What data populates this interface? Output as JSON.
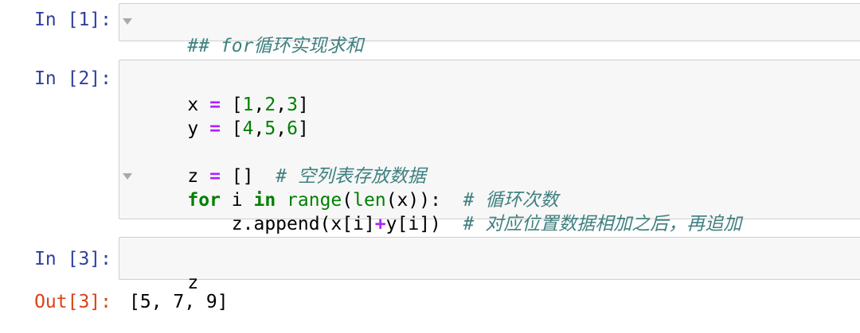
{
  "cells": [
    {
      "prompt": "In [1]:",
      "code": [
        "## for循环实现求和"
      ]
    },
    {
      "prompt": "In [2]:",
      "code": [
        "x = [1,2,3]",
        "y = [4,5,6]",
        "",
        "z = []  # 空列表存放数据",
        "for i in range(len(x)):  # 循环次数",
        "    z.append(x[i]+y[i])  # 对应位置数据相加之后，再追加"
      ]
    },
    {
      "prompt": "In [3]:",
      "code": [
        "z"
      ]
    }
  ],
  "output": {
    "prompt": "Out[3]:",
    "text": "[5, 7, 9]"
  },
  "colors": {
    "in_prompt": "#303F9F",
    "out_prompt": "#D84315",
    "comment": "#408080",
    "keyword": "#008000",
    "operator": "#AA22FF",
    "cell_bg": "#f7f7f7",
    "cell_border": "#cfcfcf"
  },
  "icons": [
    "fold-triangle-icon"
  ]
}
